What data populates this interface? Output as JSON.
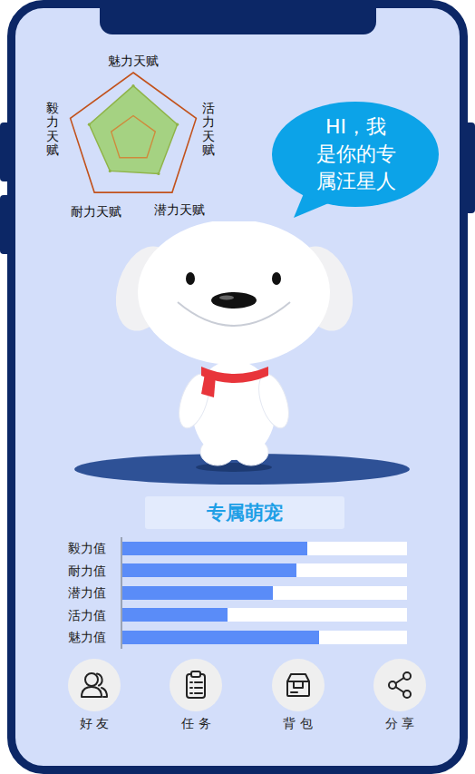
{
  "radar": {
    "axes": [
      "魅力天赋",
      "活力天赋",
      "潜力天赋",
      "耐力天赋",
      "毅力天赋"
    ],
    "values": [
      0.8,
      0.7,
      0.65,
      0.6,
      0.7
    ]
  },
  "bubble": {
    "lines": [
      "HI，我",
      "是你的专",
      "属汪星人"
    ]
  },
  "title": "专属萌宠",
  "stats": [
    {
      "label": "毅力值",
      "level": 0.65
    },
    {
      "label": "耐力值",
      "level": 0.61
    },
    {
      "label": "潜力值",
      "level": 0.53
    },
    {
      "label": "活力值",
      "level": 0.37
    },
    {
      "label": "魅力值",
      "level": 0.69
    }
  ],
  "nav": [
    {
      "label": "好 友"
    },
    {
      "label": "任 务"
    },
    {
      "label": "背 包"
    },
    {
      "label": "分 享"
    }
  ]
}
